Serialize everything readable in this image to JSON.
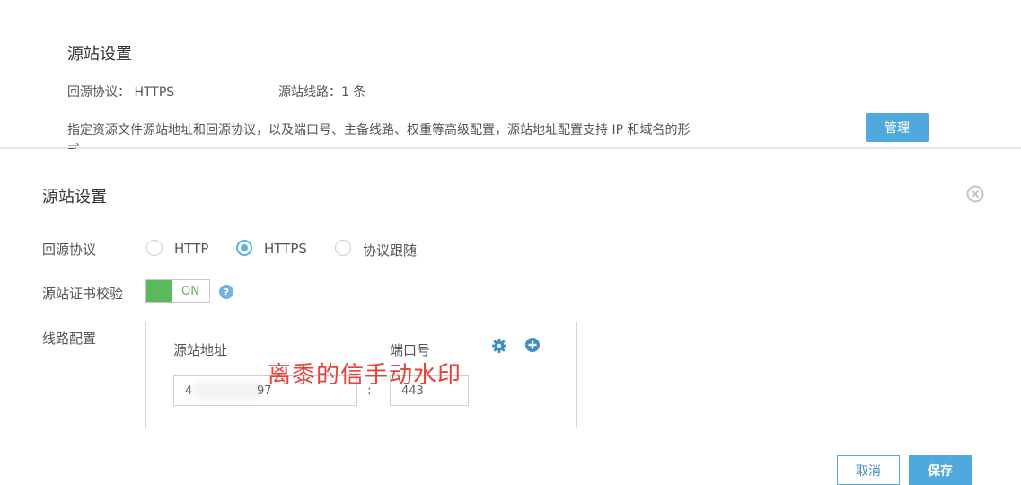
{
  "background": {
    "title": "源站设置",
    "protocol_text": "回源协议： HTTPS",
    "lines_text": "源站线路：1 条",
    "description": "指定资源文件源站地址和回源协议，以及端口号、主备线路、权重等高级配置，源站地址配置支持 IP 和域名的形式",
    "manage_label": "管理"
  },
  "modal": {
    "title": "源站设置",
    "close_icon": "close-circle-icon",
    "protocol_label": "回源协议",
    "protocol_options": [
      {
        "label": "HTTP",
        "selected": false
      },
      {
        "label": "HTTPS",
        "selected": true
      },
      {
        "label": "协议跟随",
        "selected": false
      }
    ],
    "cert_label": "源站证书校验",
    "toggle_text": "ON",
    "help_glyph": "?",
    "lines_label": "线路配置",
    "lines": {
      "addr_header": "源站地址",
      "port_header": "端口号",
      "addr_value_head": "4",
      "addr_value_tail": "97",
      "separator": ":",
      "port_value": "443"
    },
    "cancel_label": "取消",
    "save_label": "保存"
  },
  "watermark": "离黍的信手动水印",
  "colors": {
    "accent": "#4fa9dd",
    "toggle_on": "#5cb85c",
    "watermark": "#e8423a"
  }
}
